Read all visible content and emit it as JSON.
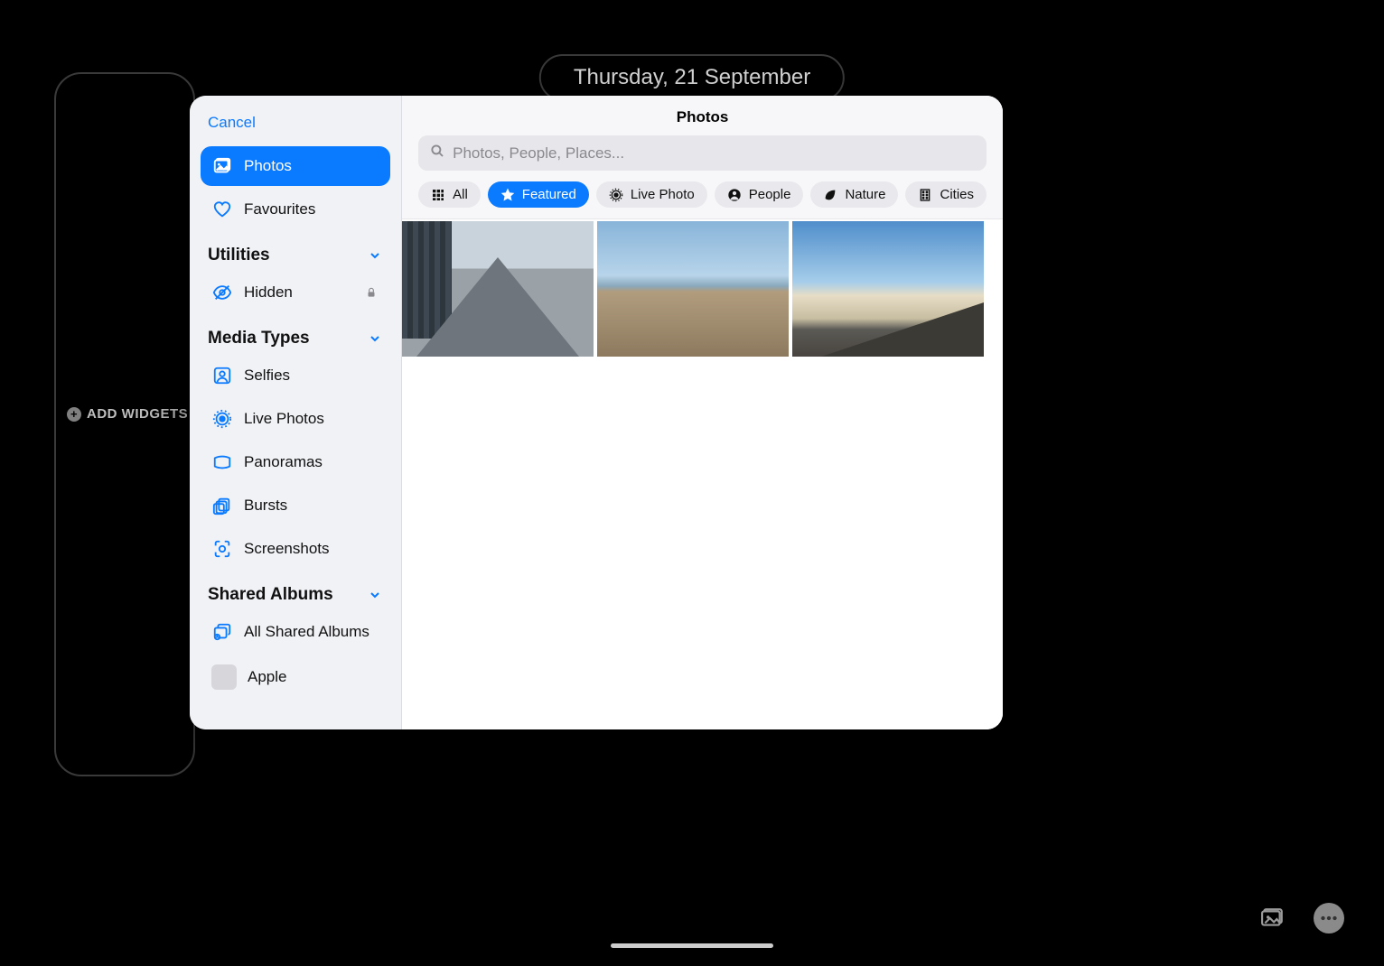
{
  "lockscreen": {
    "date_label": "Thursday, 21 September",
    "add_widgets_label": "ADD WIDGETS"
  },
  "modal": {
    "cancel_label": "Cancel",
    "title": "Photos",
    "search_placeholder": "Photos, People, Places..."
  },
  "sidebar": {
    "items": [
      {
        "label": "Photos",
        "icon": "photos",
        "active": true
      },
      {
        "label": "Favourites",
        "icon": "heart",
        "active": false
      }
    ],
    "utilities_header": "Utilities",
    "utilities": [
      {
        "label": "Hidden",
        "icon": "eye-off",
        "trailing": "lock"
      }
    ],
    "media_types_header": "Media Types",
    "media_types": [
      {
        "label": "Selfies",
        "icon": "person-square"
      },
      {
        "label": "Live Photos",
        "icon": "live"
      },
      {
        "label": "Panoramas",
        "icon": "panorama"
      },
      {
        "label": "Bursts",
        "icon": "burst"
      },
      {
        "label": "Screenshots",
        "icon": "screenshot"
      }
    ],
    "shared_header": "Shared Albums",
    "shared": [
      {
        "label": "All Shared Albums",
        "icon": "shared-stack"
      },
      {
        "label": "Apple",
        "icon": "thumb"
      }
    ]
  },
  "chips": [
    {
      "label": "All",
      "icon": "grid",
      "active": false
    },
    {
      "label": "Featured",
      "icon": "star",
      "active": true
    },
    {
      "label": "Live Photo",
      "icon": "live",
      "active": false
    },
    {
      "label": "People",
      "icon": "person",
      "active": false
    },
    {
      "label": "Nature",
      "icon": "leaf",
      "active": false
    },
    {
      "label": "Cities",
      "icon": "building",
      "active": false
    }
  ],
  "thumbnails": [
    {
      "kind": "city"
    },
    {
      "kind": "beach"
    },
    {
      "kind": "desert"
    }
  ]
}
